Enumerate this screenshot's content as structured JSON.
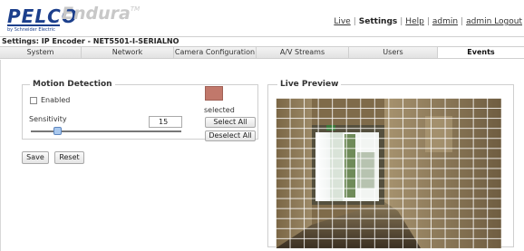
{
  "header": {
    "logo_text": "PELCO",
    "logo_sub": "by Schneider Electric",
    "product": "Endura",
    "trademark": "TM",
    "links": [
      {
        "label": "Live",
        "active": false
      },
      {
        "label": "Settings",
        "active": true
      },
      {
        "label": "Help",
        "active": false
      },
      {
        "label": "admin",
        "active": false
      },
      {
        "label": "admin Logout",
        "active": false
      }
    ]
  },
  "titlebar": {
    "text": "Settings: IP Encoder - NET5501-I-SERIALNO"
  },
  "tabs": [
    {
      "label": "System",
      "active": false
    },
    {
      "label": "Network",
      "active": false
    },
    {
      "label": "Camera Configuration",
      "active": false
    },
    {
      "label": "A/V Streams",
      "active": false
    },
    {
      "label": "Users",
      "active": false
    },
    {
      "label": "Events",
      "active": true
    }
  ],
  "motion_detection": {
    "legend": "Motion Detection",
    "enabled_label": "Enabled",
    "enabled_checked": false,
    "sensitivity_label": "Sensitivity",
    "sensitivity_value": "15",
    "sensitivity_fraction": 0.15,
    "selected_label": "selected",
    "selected_color": "#c1786b",
    "select_all_label": "Select All",
    "deselect_all_label": "Deselect All"
  },
  "actions": {
    "save_label": "Save",
    "reset_label": "Reset"
  },
  "live_preview": {
    "legend": "Live Preview",
    "grid_cols": 16,
    "grid_rows": 15
  }
}
